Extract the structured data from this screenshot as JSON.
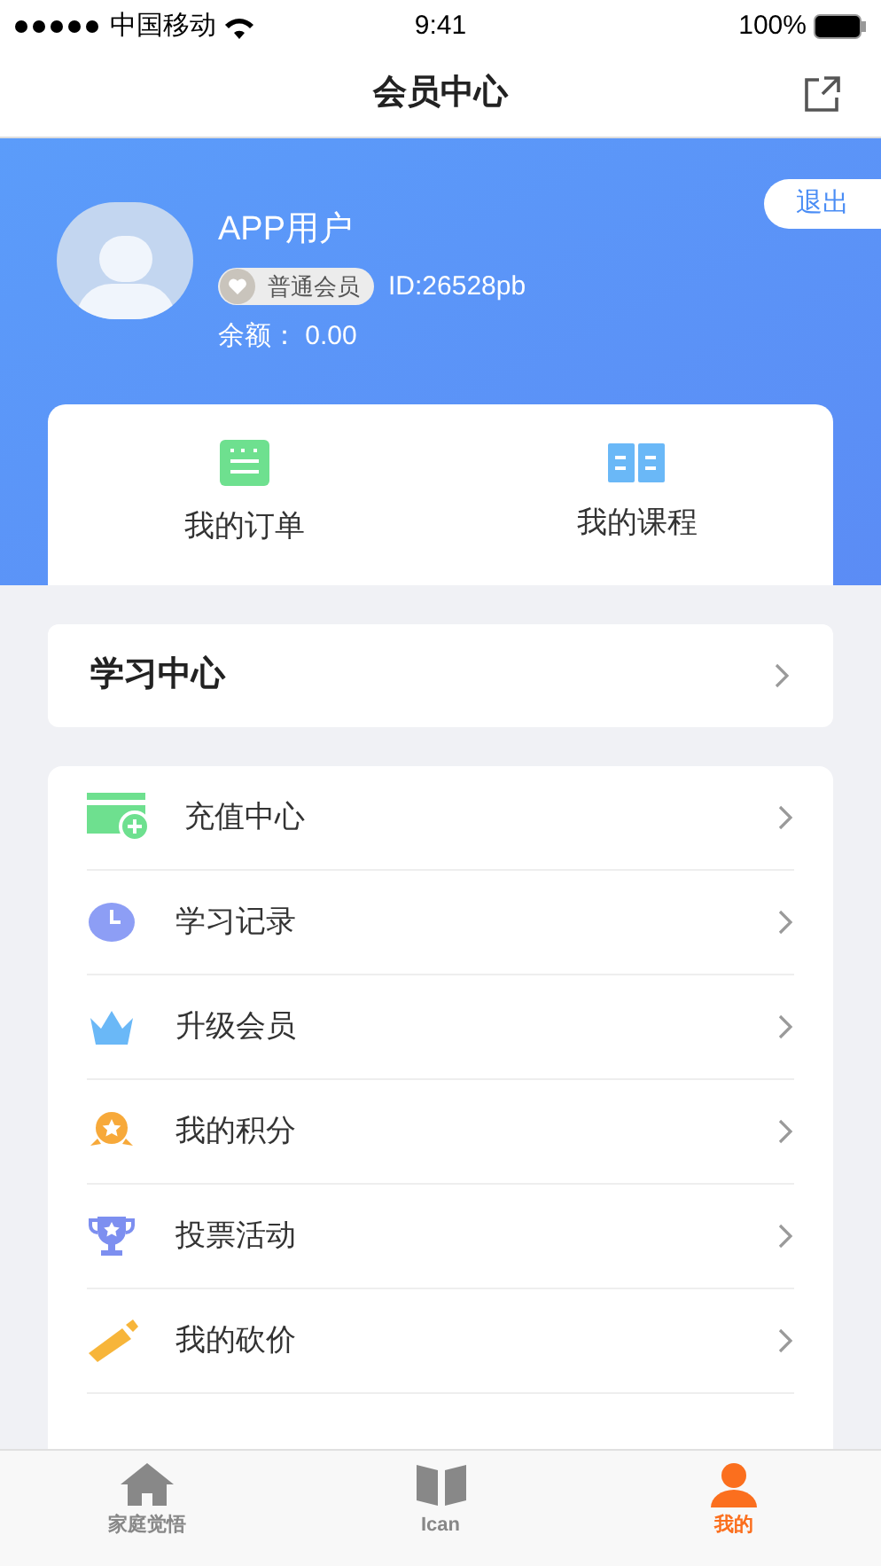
{
  "status_bar": {
    "carrier": "中国移动",
    "time": "9:41",
    "battery": "100%"
  },
  "nav": {
    "title": "会员中心"
  },
  "profile": {
    "name": "APP用户",
    "badge": "普通会员",
    "id": "ID:26528pb",
    "balance": "余额： 0.00",
    "logout": "退出"
  },
  "shortcuts": [
    {
      "label": "我的订单"
    },
    {
      "label": "我的课程"
    }
  ],
  "study_center": {
    "label": "学习中心"
  },
  "menu": [
    {
      "label": "充值中心"
    },
    {
      "label": "学习记录"
    },
    {
      "label": "升级会员"
    },
    {
      "label": "我的积分"
    },
    {
      "label": "投票活动"
    },
    {
      "label": "我的砍价"
    }
  ],
  "tab_bar": [
    {
      "label": "家庭觉悟",
      "selected": false
    },
    {
      "label": "Ican",
      "selected": false
    },
    {
      "label": "我的",
      "selected": true
    }
  ]
}
